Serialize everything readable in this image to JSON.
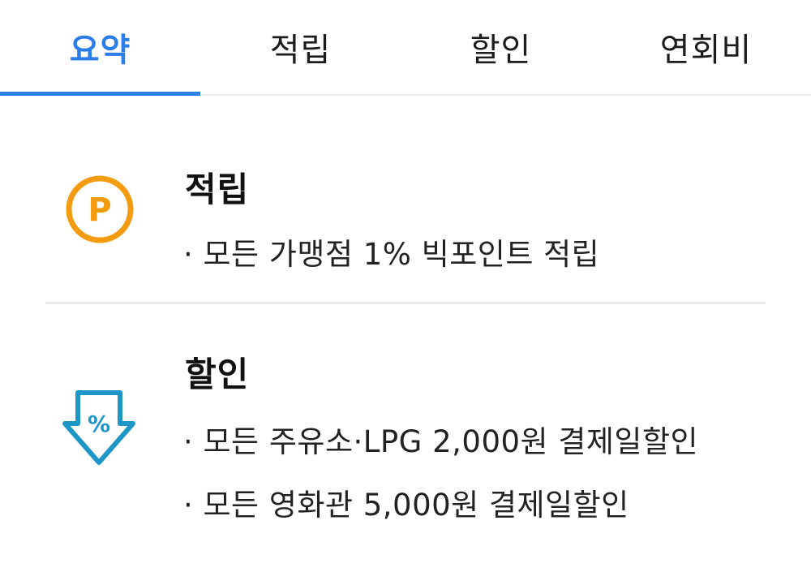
{
  "tabs": [
    {
      "label": "요약",
      "active": true
    },
    {
      "label": "적립",
      "active": false
    },
    {
      "label": "할인",
      "active": false
    },
    {
      "label": "연회비",
      "active": false
    }
  ],
  "colors": {
    "accent": "#2b7de9",
    "point_icon": "#f39c12",
    "discount_icon": "#1e96c8"
  },
  "sections": {
    "points": {
      "icon": "point-circle-icon",
      "icon_letter": "P",
      "title": "적립",
      "items": [
        "· 모든 가맹점 1% 빅포인트 적립"
      ]
    },
    "discount": {
      "icon": "discount-arrow-icon",
      "icon_symbol": "%",
      "title": "할인",
      "items": [
        "· 모든 주유소·LPG 2,000원 결제일할인",
        "· 모든 영화관 5,000원 결제일할인"
      ]
    }
  }
}
